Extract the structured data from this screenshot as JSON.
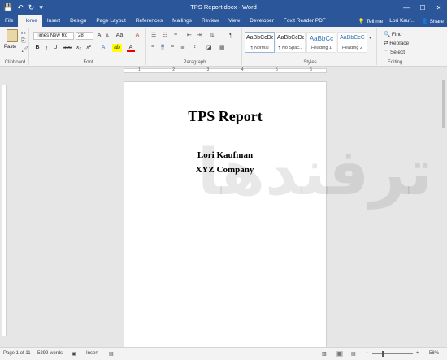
{
  "window": {
    "title": "TPS Report.docx - Word",
    "controls": [
      "—",
      "☐",
      "✕"
    ]
  },
  "qat": {
    "save": "💾",
    "undo": "↶",
    "redo": "↻",
    "more": "▾"
  },
  "tabs": [
    "File",
    "Home",
    "Insert",
    "Design",
    "Page Layout",
    "References",
    "Mailings",
    "Review",
    "View",
    "Developer",
    "Foxit Reader PDF"
  ],
  "active_tab": "Home",
  "tabs_right": {
    "tell_me": "Tell me",
    "user": "Lori Kauf...",
    "share": "Share"
  },
  "ribbon": {
    "clipboard": {
      "label": "Clipboard",
      "paste": "Paste"
    },
    "font": {
      "label": "Font",
      "font_name": "Times New Ro",
      "font_size": "28",
      "grow": "A",
      "shrink": "A",
      "case": "Aa",
      "clear": "A",
      "bold": "B",
      "italic": "I",
      "underline": "U",
      "strike": "abc",
      "sub": "x₂",
      "sup": "x²",
      "effects": "A",
      "highlight": "ab",
      "color": "A"
    },
    "paragraph": {
      "label": "Paragraph",
      "pilcrow": "¶"
    },
    "styles": {
      "label": "Styles",
      "items": [
        {
          "preview": "AaBbCcDc",
          "name": "¶ Normal"
        },
        {
          "preview": "AaBbCcDc",
          "name": "¶ No Spac..."
        },
        {
          "preview": "AaBbCc",
          "name": "Heading 1"
        },
        {
          "preview": "AaBbCcC",
          "name": "Heading 2"
        }
      ]
    },
    "editing": {
      "label": "Editing",
      "find": "Find",
      "replace": "Replace",
      "select": "Select"
    }
  },
  "document": {
    "heading": "TPS Report",
    "line1": "Lori Kaufman",
    "line2": "XYZ Company"
  },
  "watermark": "ترفندها",
  "status": {
    "page": "Page 1 of 11",
    "words": "5299 words",
    "mode": "Insert",
    "zoom": "58%",
    "zoom_level": 0.58
  },
  "colors": {
    "accent": "#2b579a",
    "ribbon_bg": "#f3f3f3",
    "canvas_bg": "#e6e6e6"
  }
}
